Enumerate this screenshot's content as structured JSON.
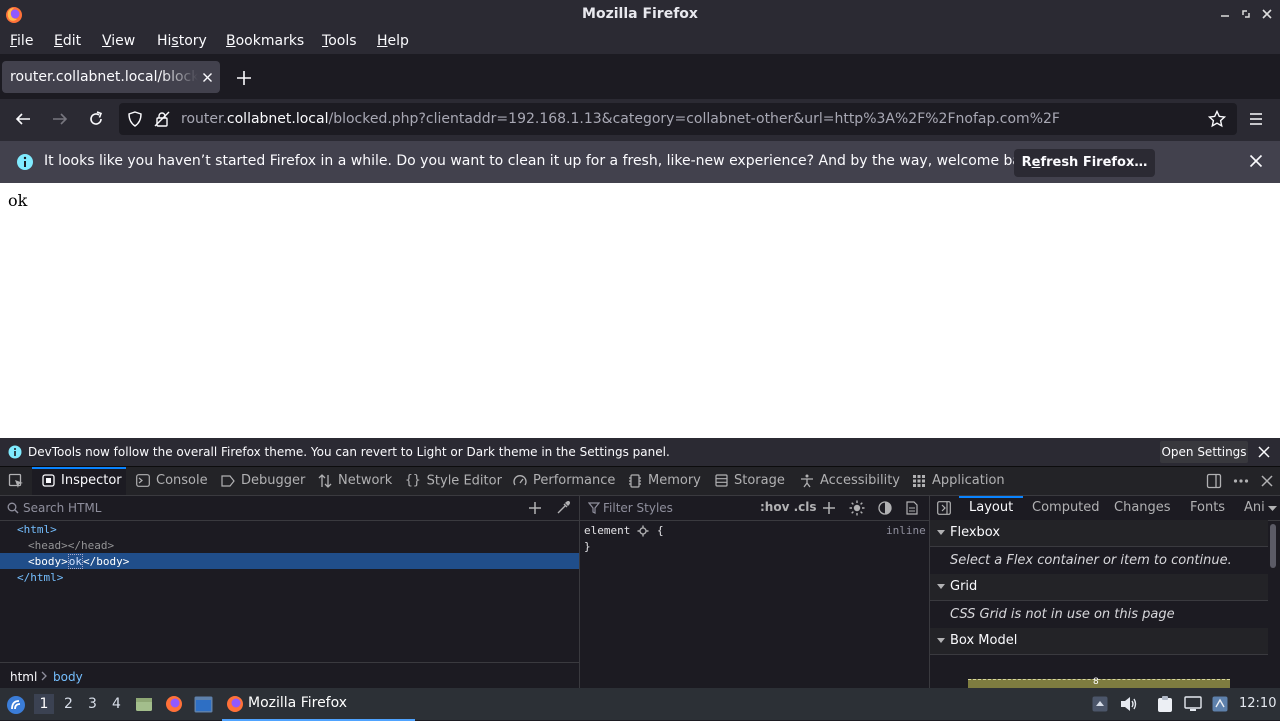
{
  "window": {
    "title": "Mozilla Firefox"
  },
  "menubar": {
    "items": [
      {
        "pre": "",
        "u": "F",
        "post": "ile"
      },
      {
        "pre": "",
        "u": "E",
        "post": "dit"
      },
      {
        "pre": "",
        "u": "V",
        "post": "iew"
      },
      {
        "pre": "Hi",
        "u": "s",
        "post": "tory"
      },
      {
        "pre": "",
        "u": "B",
        "post": "ookmarks"
      },
      {
        "pre": "",
        "u": "T",
        "post": "ools"
      },
      {
        "pre": "",
        "u": "H",
        "post": "elp"
      }
    ]
  },
  "tab": {
    "label": "router.collabnet.local/blocked.php"
  },
  "urlbar": {
    "host_pre": "router.",
    "host": "collabnet.local",
    "path": "/blocked.php?clientaddr=192.168.1.13&category=collabnet-other&url=http%3A%2F%2Fnofap.com%2F"
  },
  "notification": {
    "message": "It looks like you haven’t started Firefox in a while. Do you want to clean it up for a fresh, like-new experience? And by the way, welcome back!",
    "button_pre": "R",
    "button_u": "e",
    "button_post": "fresh Firefox…"
  },
  "page": {
    "body_text": "ok"
  },
  "devtools": {
    "notice": "DevTools now follow the overall Firefox theme. You can revert to Light or Dark theme in the Settings panel.",
    "open_settings": "Open Settings",
    "tabs": {
      "inspector": "Inspector",
      "console": "Console",
      "debugger": "Debugger",
      "network": "Network",
      "style_editor": "Style Editor",
      "performance": "Performance",
      "memory": "Memory",
      "storage": "Storage",
      "accessibility": "Accessibility",
      "application": "Application"
    },
    "markup": {
      "search_placeholder": "Search HTML",
      "lines": {
        "html_open": "<html>",
        "head": "<head></head>",
        "body_open": "<body>",
        "body_text": "ok",
        "body_close": "</body>",
        "html_close": "</html>"
      },
      "breadcrumbs": [
        "html",
        "body"
      ]
    },
    "rules": {
      "filter_placeholder": "Filter Styles",
      "hov_cls": ":hov .cls",
      "selector": "element",
      "brace_open": "{",
      "brace_close": "}",
      "source": "inline"
    },
    "layout": {
      "tabs": [
        "Layout",
        "Computed",
        "Changes",
        "Fonts",
        "Ani"
      ],
      "flexbox": {
        "title": "Flexbox",
        "message": "Select a Flex container or item to continue."
      },
      "grid": {
        "title": "Grid",
        "message": "CSS Grid is not in use on this page"
      },
      "box_model": {
        "title": "Box Model",
        "margin_value": "8"
      }
    }
  },
  "taskbar": {
    "workspaces": [
      "1",
      "2",
      "3",
      "4"
    ],
    "active_workspace": "1",
    "app_label": "Mozilla Firefox",
    "clock": "12:10"
  },
  "colors": {
    "accent": "#0a84ff",
    "selection": "#204e8a",
    "tag": "#75bfff"
  }
}
